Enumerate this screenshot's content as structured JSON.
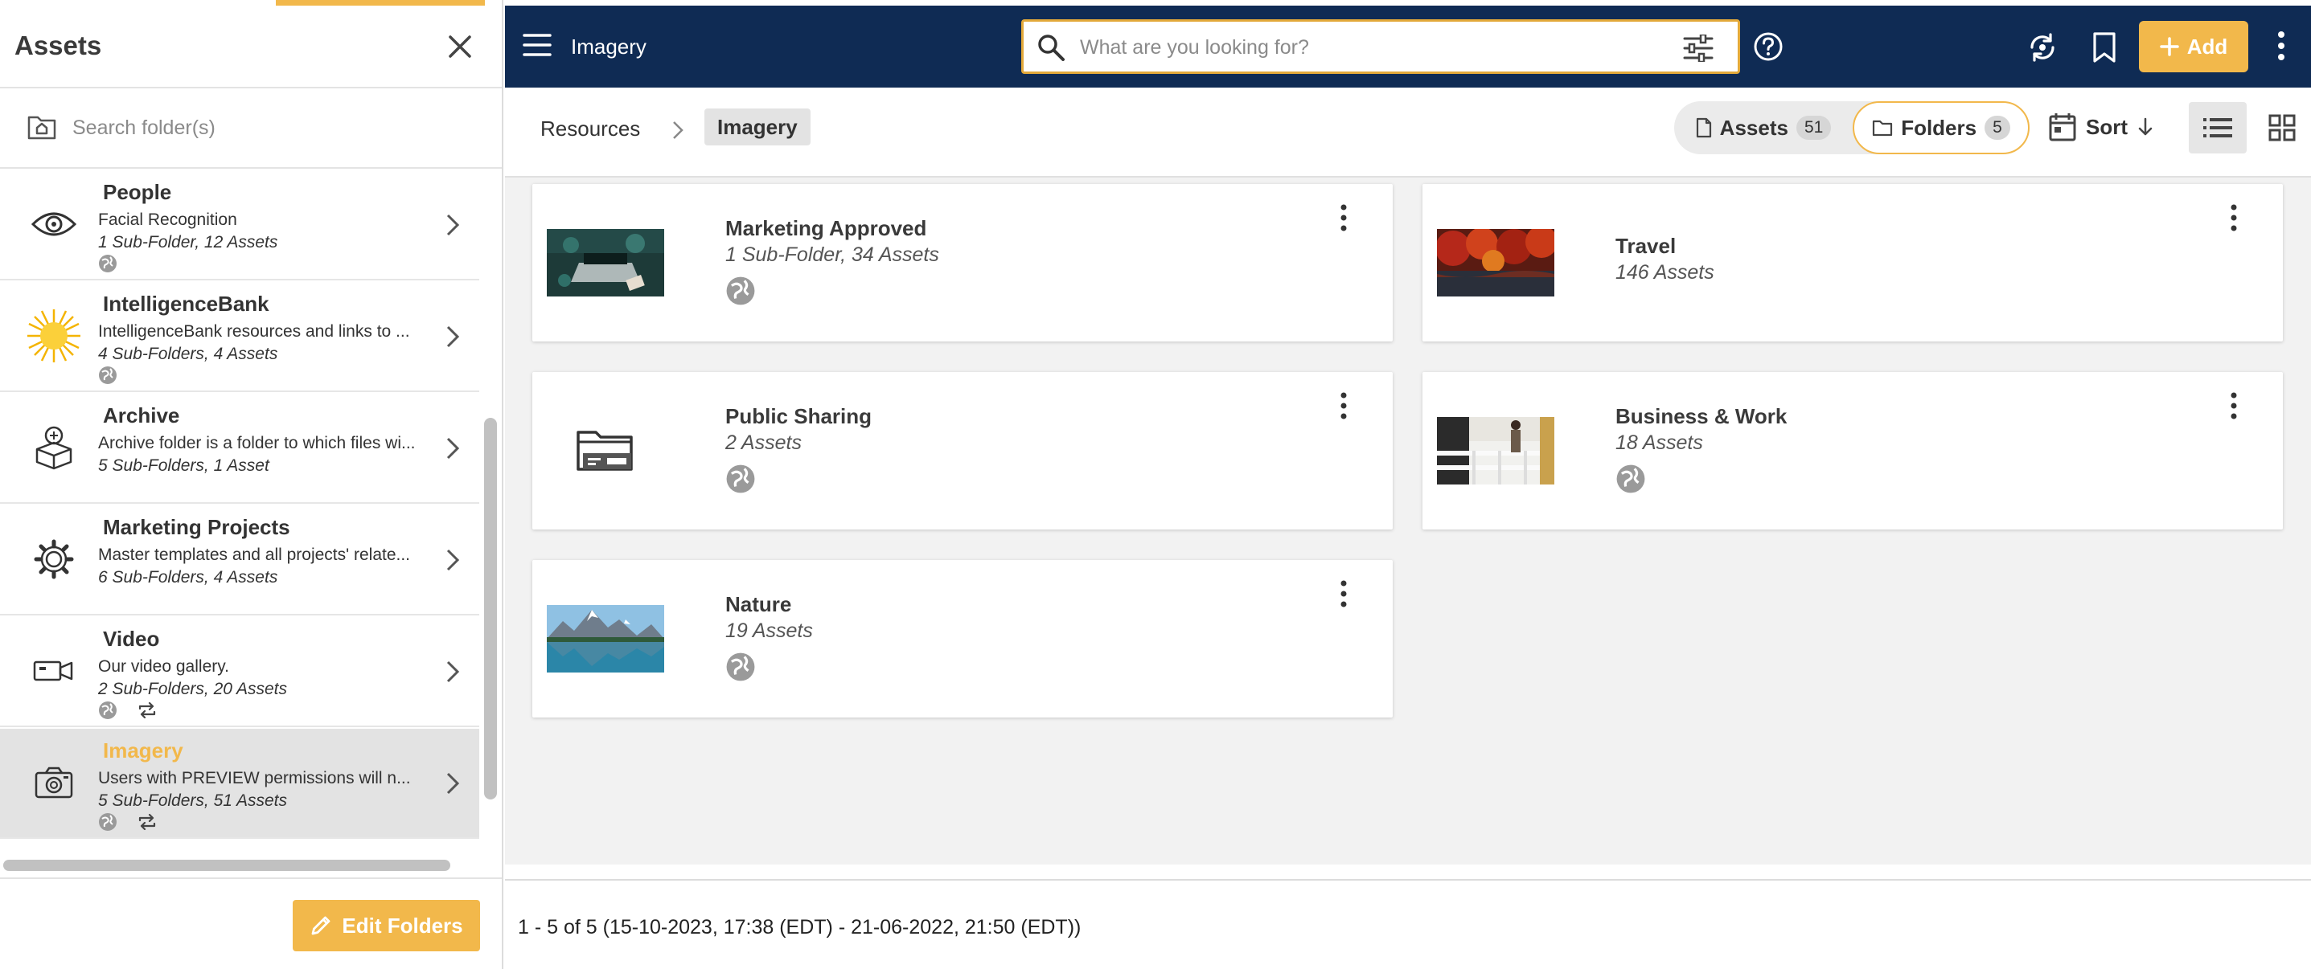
{
  "left_panel": {
    "title": "Assets",
    "search_placeholder": "Search folder(s)",
    "folders": [
      {
        "name": "People",
        "description": "Facial Recognition",
        "meta": "1 Sub-Folder, 12 Assets",
        "icon": "eye-icon",
        "public": true,
        "synced": false
      },
      {
        "name": "IntelligenceBank",
        "description": "IntelligenceBank resources and links to ...",
        "meta": "4 Sub-Folders, 4 Assets",
        "icon": "sun-icon",
        "public": true,
        "synced": false
      },
      {
        "name": "Archive",
        "description": "Archive folder is a folder to which files wi...",
        "meta": "5 Sub-Folders, 1 Asset",
        "icon": "archive-box-icon",
        "public": false,
        "synced": false
      },
      {
        "name": "Marketing Projects",
        "description": "Master templates and all projects' relate...",
        "meta": "6 Sub-Folders, 4 Assets",
        "icon": "gear-icon",
        "public": false,
        "synced": false
      },
      {
        "name": "Video",
        "description": "Our video gallery.",
        "meta": "2 Sub-Folders, 20 Assets",
        "icon": "video-camera-icon",
        "public": true,
        "synced": true
      },
      {
        "name": "Imagery",
        "description": "Users with PREVIEW permissions will n...",
        "meta": "5 Sub-Folders, 51 Assets",
        "icon": "camera-icon",
        "public": true,
        "synced": true,
        "selected": true
      }
    ],
    "edit_button": "Edit Folders"
  },
  "topbar": {
    "title": "Imagery",
    "search_placeholder": "What are you looking for?",
    "add_label": "Add",
    "colors": {
      "bar": "#0f2b54",
      "accent": "#f2b84b"
    }
  },
  "subbar": {
    "breadcrumb": [
      "Resources",
      "Imagery"
    ],
    "assets_label": "Assets",
    "assets_count": "51",
    "folders_label": "Folders",
    "folders_count": "5",
    "sort_label": "Sort"
  },
  "cards": [
    {
      "title": "Marketing Approved",
      "meta": "1 Sub-Folder, 34 Assets",
      "thumb": "laptop-photo"
    },
    {
      "title": "Travel",
      "meta": "146 Assets",
      "thumb": "autumn-trees-photo"
    },
    {
      "title": "Public Sharing",
      "meta": "2 Assets",
      "thumb": "folder-icon"
    },
    {
      "title": "Business & Work",
      "meta": "18 Assets",
      "thumb": "balcony-photo"
    },
    {
      "title": "Nature",
      "meta": "19 Assets",
      "thumb": "mountain-lake-photo"
    }
  ],
  "footer": {
    "pagination": "1 - 5 of 5 (15-10-2023, 17:38 (EDT) - 21-06-2022, 21:50 (EDT))"
  }
}
